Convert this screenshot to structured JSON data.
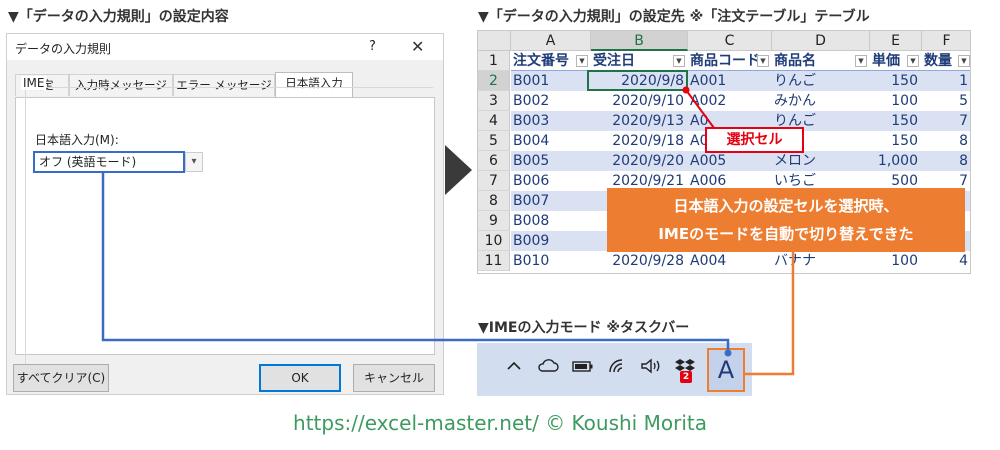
{
  "headings": {
    "dialog_section": "▼「データの入力規則」の設定内容",
    "sheet_section": "▼「データの入力規則」の設定先 ※「注文テーブル」テーブル",
    "taskbar_section": "▼IMEの入力モード ※タスクバー"
  },
  "dialog": {
    "title": "データの入力規則",
    "help": "?",
    "close": "✕",
    "tabs": [
      "設定",
      "入力時メッセージ",
      "エラー メッセージ",
      "日本語入力"
    ],
    "active_tab": "日本語入力",
    "group_label": "IME",
    "field_label": "日本語入力(M):",
    "select_value": "オフ (英語モード)",
    "clear_all_button": "すべてクリア(C)",
    "ok_button": "OK",
    "cancel_button": "キャンセル"
  },
  "sheet": {
    "columns": [
      "A",
      "B",
      "C",
      "D",
      "E",
      "F"
    ],
    "selected_column": "B",
    "row_numbers": [
      "1",
      "2",
      "3",
      "4",
      "5",
      "6",
      "7",
      "8",
      "9",
      "10",
      "11"
    ],
    "selected_row": "2",
    "table_headers": [
      "注文番号",
      "受注日",
      "商品コード",
      "商品名",
      "単価",
      "数量"
    ],
    "rows": [
      [
        "B001",
        "2020/9/8",
        "A001",
        "りんご",
        "150",
        "1"
      ],
      [
        "B002",
        "2020/9/10",
        "A002",
        "みかん",
        "100",
        "5"
      ],
      [
        "B003",
        "2020/9/13",
        "A0",
        "りんご",
        "150",
        "7"
      ],
      [
        "B004",
        "2020/9/18",
        "A0",
        "",
        "150",
        "8"
      ],
      [
        "B005",
        "2020/9/20",
        "A005",
        "メロン",
        "1,000",
        "8"
      ],
      [
        "B006",
        "2020/9/21",
        "A006",
        "いちご",
        "500",
        "7"
      ],
      [
        "B007",
        "",
        "",
        "",
        "",
        ""
      ],
      [
        "B008",
        "",
        "",
        "",
        "",
        ""
      ],
      [
        "B009",
        "",
        "",
        "",
        "",
        ""
      ],
      [
        "B010",
        "2020/9/28",
        "A004",
        "バナナ",
        "100",
        "4"
      ]
    ]
  },
  "callouts": {
    "selected_cell": "選択セル",
    "ime_line1": "日本語入力の設定セルを選択時、",
    "ime_line2": "IMEのモードを自動で切り替えできた"
  },
  "taskbar": {
    "icons": [
      "chevron-up-icon",
      "cloud-icon",
      "battery-icon",
      "wifi-icon",
      "speaker-icon",
      "dropbox-icon"
    ],
    "dropbox_badge": "2",
    "ime_mode": "A"
  },
  "colors": {
    "dialog_highlight": "#3a6bc6",
    "orange": "#ed7d31",
    "red": "#e60012",
    "excel_green": "#217346",
    "table_band": "#d9e1f2",
    "footer": "#3d9b5f"
  },
  "footer": "https://excel-master.net/  © Koushi Morita"
}
